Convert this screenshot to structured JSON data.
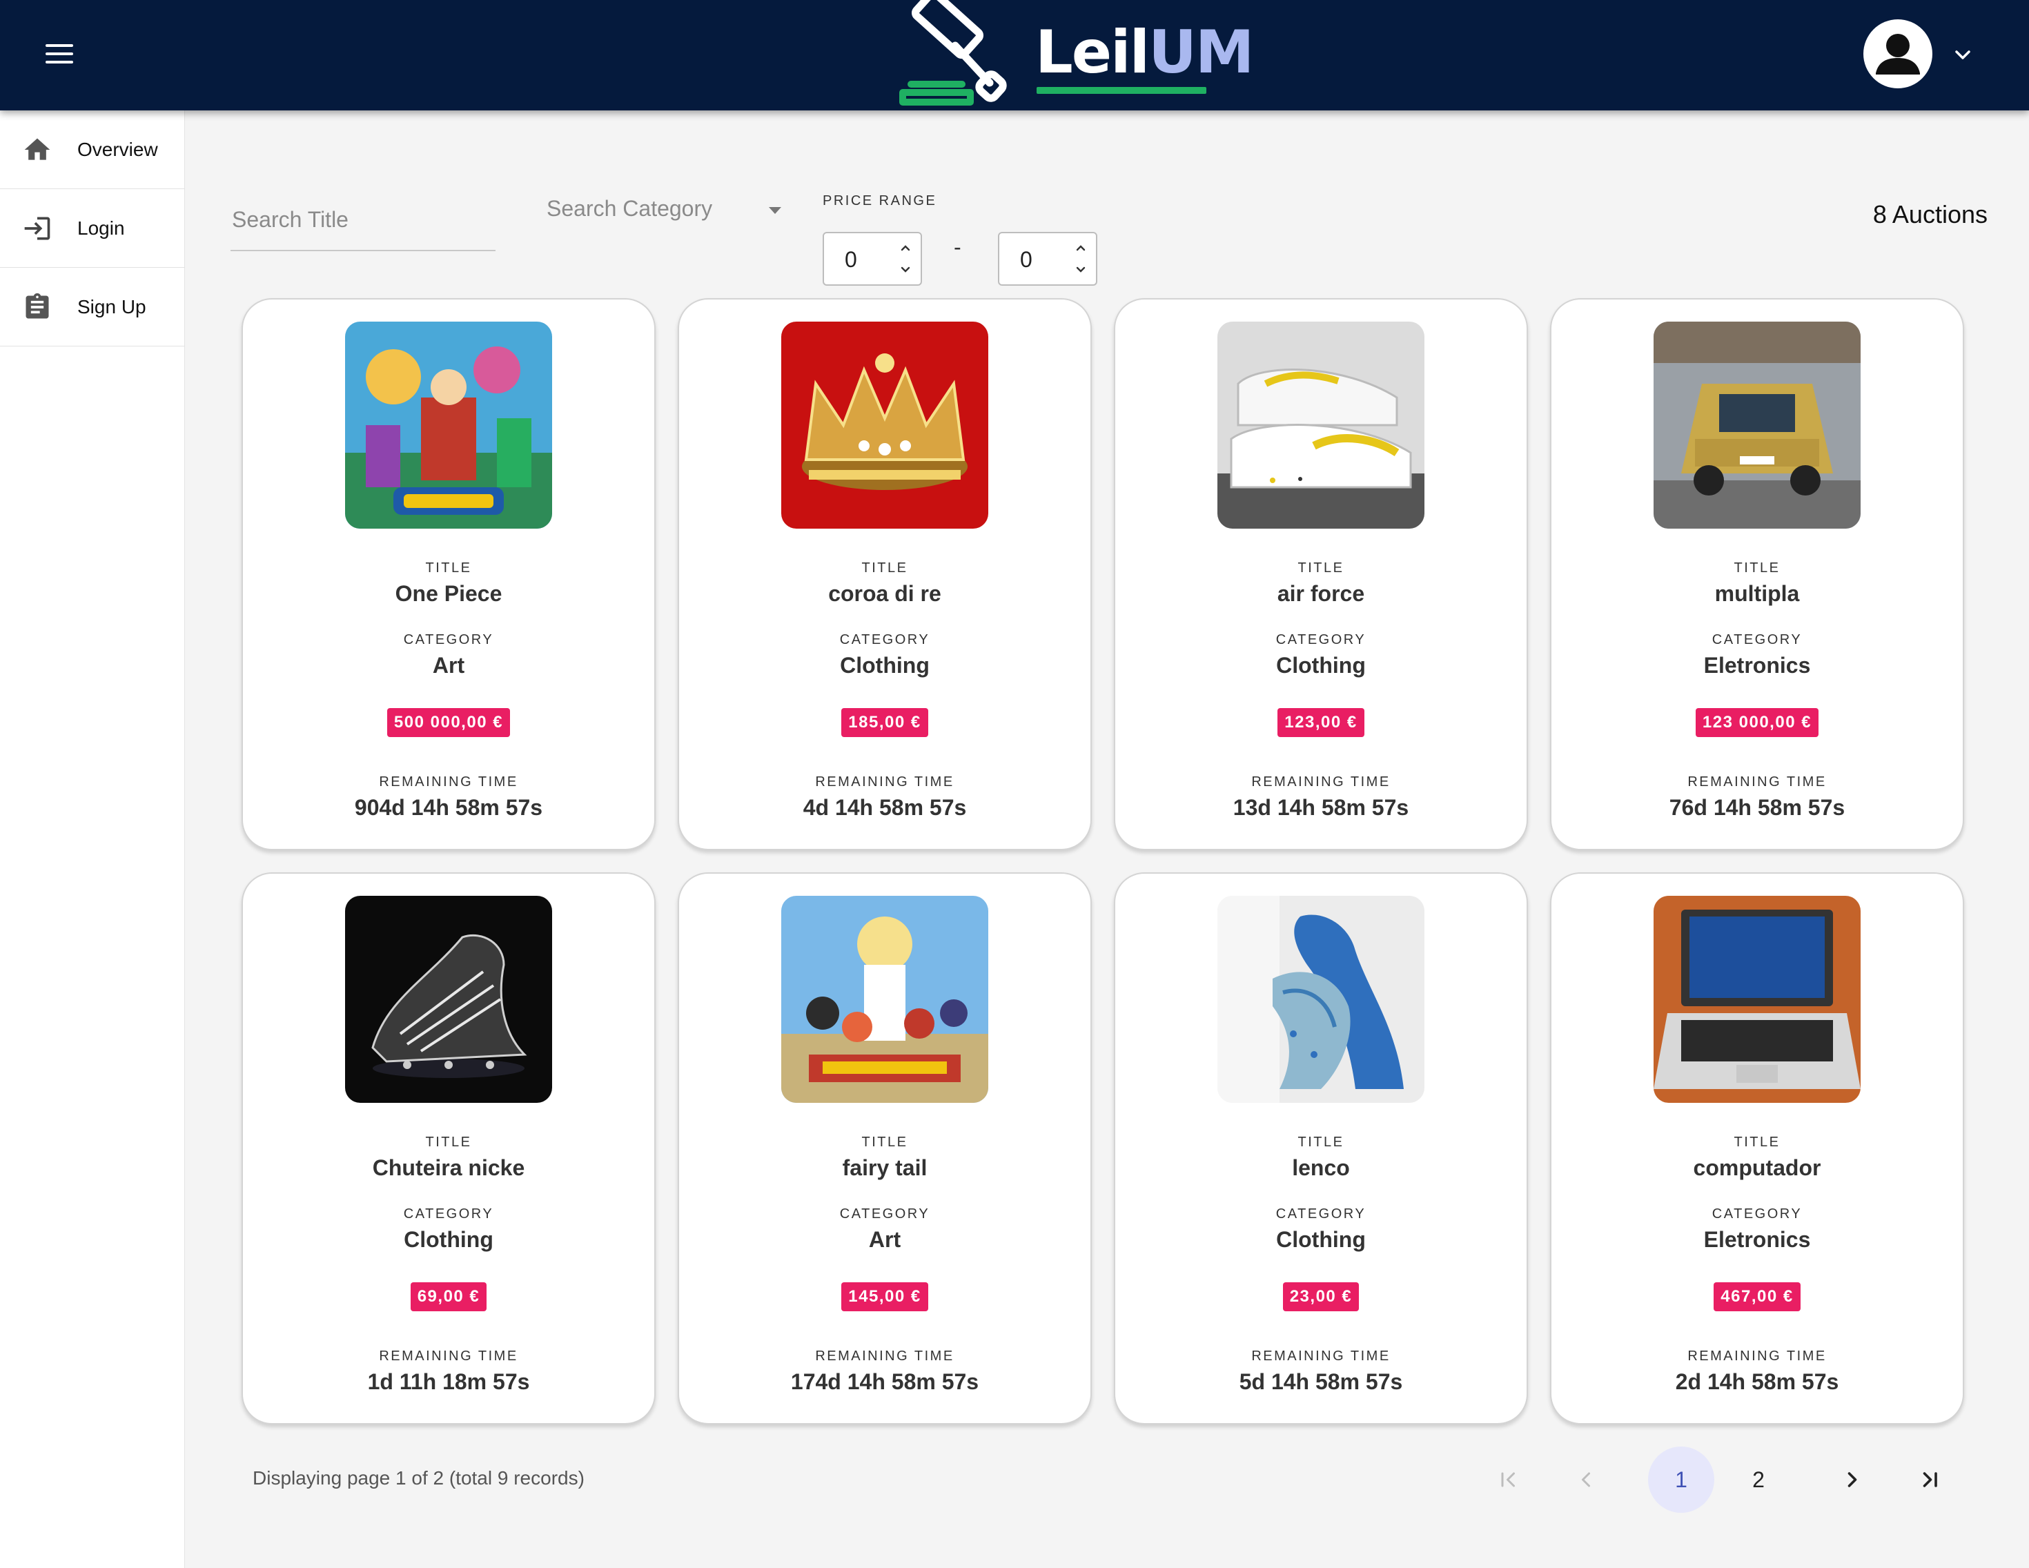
{
  "header": {
    "logo_text_light": "Leil",
    "logo_text_accent": "UM",
    "menu_icon": "hamburger-icon",
    "user_icon": "account-circle-icon",
    "dropdown_icon": "chevron-down-icon"
  },
  "sidebar": {
    "items": [
      {
        "label": "Overview",
        "icon": "home-icon"
      },
      {
        "label": "Login",
        "icon": "login-icon"
      },
      {
        "label": "Sign Up",
        "icon": "clipboard-icon"
      }
    ]
  },
  "filters": {
    "search_title_placeholder": "Search Title",
    "search_category_placeholder": "Search Category",
    "price_range_label": "PRICE RANGE",
    "price_min": "0",
    "price_max": "0",
    "range_separator": "-"
  },
  "auctions_count": "8 Auctions",
  "card_labels": {
    "title": "TITLE",
    "category": "CATEGORY",
    "remaining": "REMAINING TIME"
  },
  "auctions": [
    {
      "title": "One Piece",
      "category": "Art",
      "price": "500 000,00 €",
      "remaining": "904d 14h 58m 57s"
    },
    {
      "title": "coroa di re",
      "category": "Clothing",
      "price": "185,00 €",
      "remaining": "4d 14h 58m 57s"
    },
    {
      "title": "air force",
      "category": "Clothing",
      "price": "123,00 €",
      "remaining": "13d 14h 58m 57s"
    },
    {
      "title": "multipla",
      "category": "Eletronics",
      "price": "123 000,00 €",
      "remaining": "76d 14h 58m 57s"
    },
    {
      "title": "Chuteira nicke",
      "category": "Clothing",
      "price": "69,00 €",
      "remaining": "1d 11h 18m 57s"
    },
    {
      "title": "fairy tail",
      "category": "Art",
      "price": "145,00 €",
      "remaining": "174d 14h 58m 57s"
    },
    {
      "title": "lenco",
      "category": "Clothing",
      "price": "23,00 €",
      "remaining": "5d 14h 58m 57s"
    },
    {
      "title": "computador",
      "category": "Eletronics",
      "price": "467,00 €",
      "remaining": "2d 14h 58m 57s"
    }
  ],
  "pagination": {
    "info": "Displaying page 1 of 2 (total 9 records)",
    "pages": [
      "1",
      "2"
    ],
    "current": "1"
  },
  "colors": {
    "header_bg": "#051a3d",
    "logo_accent": "#a9b8ef",
    "logo_underline": "#1fb062",
    "price_badge": "#e91e63",
    "active_page_bg": "#e6e7fb",
    "active_page_text": "#3f51b5"
  }
}
